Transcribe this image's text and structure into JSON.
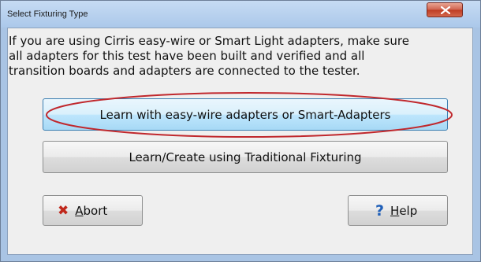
{
  "window": {
    "title": "Select Fixturing Type"
  },
  "message": {
    "lines": [
      "If you are using Cirris easy-wire or Smart Light adapters, make sure",
      "all adapters for this test have been built and verified and all",
      "transition boards and adapters are connected to the tester."
    ]
  },
  "buttons": {
    "learn_easy_wire": "Learn with easy-wire adapters or Smart-Adapters",
    "learn_traditional": "Learn/Create using Traditional Fixturing",
    "abort_mnemonic": "A",
    "abort_rest": "bort",
    "help_mnemonic": "H",
    "help_rest": "elp"
  },
  "icons": {
    "close": "close-icon",
    "abort": "x-icon",
    "help": "question-icon"
  },
  "colors": {
    "highlight_ellipse": "#c0282d",
    "abort_icon": "#c0281c",
    "help_icon": "#1f5fb8",
    "close_button": "#c9503a"
  }
}
